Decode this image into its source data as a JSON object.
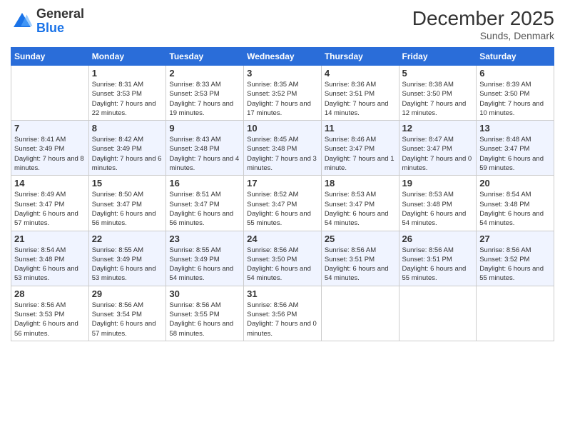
{
  "logo": {
    "general": "General",
    "blue": "Blue"
  },
  "title": "December 2025",
  "location": "Sunds, Denmark",
  "days_of_week": [
    "Sunday",
    "Monday",
    "Tuesday",
    "Wednesday",
    "Thursday",
    "Friday",
    "Saturday"
  ],
  "weeks": [
    [
      {
        "day": "",
        "info": ""
      },
      {
        "day": "1",
        "info": "Sunrise: 8:31 AM\nSunset: 3:53 PM\nDaylight: 7 hours\nand 22 minutes."
      },
      {
        "day": "2",
        "info": "Sunrise: 8:33 AM\nSunset: 3:53 PM\nDaylight: 7 hours\nand 19 minutes."
      },
      {
        "day": "3",
        "info": "Sunrise: 8:35 AM\nSunset: 3:52 PM\nDaylight: 7 hours\nand 17 minutes."
      },
      {
        "day": "4",
        "info": "Sunrise: 8:36 AM\nSunset: 3:51 PM\nDaylight: 7 hours\nand 14 minutes."
      },
      {
        "day": "5",
        "info": "Sunrise: 8:38 AM\nSunset: 3:50 PM\nDaylight: 7 hours\nand 12 minutes."
      },
      {
        "day": "6",
        "info": "Sunrise: 8:39 AM\nSunset: 3:50 PM\nDaylight: 7 hours\nand 10 minutes."
      }
    ],
    [
      {
        "day": "7",
        "info": "Sunrise: 8:41 AM\nSunset: 3:49 PM\nDaylight: 7 hours\nand 8 minutes."
      },
      {
        "day": "8",
        "info": "Sunrise: 8:42 AM\nSunset: 3:49 PM\nDaylight: 7 hours\nand 6 minutes."
      },
      {
        "day": "9",
        "info": "Sunrise: 8:43 AM\nSunset: 3:48 PM\nDaylight: 7 hours\nand 4 minutes."
      },
      {
        "day": "10",
        "info": "Sunrise: 8:45 AM\nSunset: 3:48 PM\nDaylight: 7 hours\nand 3 minutes."
      },
      {
        "day": "11",
        "info": "Sunrise: 8:46 AM\nSunset: 3:47 PM\nDaylight: 7 hours\nand 1 minute."
      },
      {
        "day": "12",
        "info": "Sunrise: 8:47 AM\nSunset: 3:47 PM\nDaylight: 7 hours\nand 0 minutes."
      },
      {
        "day": "13",
        "info": "Sunrise: 8:48 AM\nSunset: 3:47 PM\nDaylight: 6 hours\nand 59 minutes."
      }
    ],
    [
      {
        "day": "14",
        "info": "Sunrise: 8:49 AM\nSunset: 3:47 PM\nDaylight: 6 hours\nand 57 minutes."
      },
      {
        "day": "15",
        "info": "Sunrise: 8:50 AM\nSunset: 3:47 PM\nDaylight: 6 hours\nand 56 minutes."
      },
      {
        "day": "16",
        "info": "Sunrise: 8:51 AM\nSunset: 3:47 PM\nDaylight: 6 hours\nand 56 minutes."
      },
      {
        "day": "17",
        "info": "Sunrise: 8:52 AM\nSunset: 3:47 PM\nDaylight: 6 hours\nand 55 minutes."
      },
      {
        "day": "18",
        "info": "Sunrise: 8:53 AM\nSunset: 3:47 PM\nDaylight: 6 hours\nand 54 minutes."
      },
      {
        "day": "19",
        "info": "Sunrise: 8:53 AM\nSunset: 3:48 PM\nDaylight: 6 hours\nand 54 minutes."
      },
      {
        "day": "20",
        "info": "Sunrise: 8:54 AM\nSunset: 3:48 PM\nDaylight: 6 hours\nand 54 minutes."
      }
    ],
    [
      {
        "day": "21",
        "info": "Sunrise: 8:54 AM\nSunset: 3:48 PM\nDaylight: 6 hours\nand 53 minutes."
      },
      {
        "day": "22",
        "info": "Sunrise: 8:55 AM\nSunset: 3:49 PM\nDaylight: 6 hours\nand 53 minutes."
      },
      {
        "day": "23",
        "info": "Sunrise: 8:55 AM\nSunset: 3:49 PM\nDaylight: 6 hours\nand 54 minutes."
      },
      {
        "day": "24",
        "info": "Sunrise: 8:56 AM\nSunset: 3:50 PM\nDaylight: 6 hours\nand 54 minutes."
      },
      {
        "day": "25",
        "info": "Sunrise: 8:56 AM\nSunset: 3:51 PM\nDaylight: 6 hours\nand 54 minutes."
      },
      {
        "day": "26",
        "info": "Sunrise: 8:56 AM\nSunset: 3:51 PM\nDaylight: 6 hours\nand 55 minutes."
      },
      {
        "day": "27",
        "info": "Sunrise: 8:56 AM\nSunset: 3:52 PM\nDaylight: 6 hours\nand 55 minutes."
      }
    ],
    [
      {
        "day": "28",
        "info": "Sunrise: 8:56 AM\nSunset: 3:53 PM\nDaylight: 6 hours\nand 56 minutes."
      },
      {
        "day": "29",
        "info": "Sunrise: 8:56 AM\nSunset: 3:54 PM\nDaylight: 6 hours\nand 57 minutes."
      },
      {
        "day": "30",
        "info": "Sunrise: 8:56 AM\nSunset: 3:55 PM\nDaylight: 6 hours\nand 58 minutes."
      },
      {
        "day": "31",
        "info": "Sunrise: 8:56 AM\nSunset: 3:56 PM\nDaylight: 7 hours\nand 0 minutes."
      },
      {
        "day": "",
        "info": ""
      },
      {
        "day": "",
        "info": ""
      },
      {
        "day": "",
        "info": ""
      }
    ]
  ]
}
